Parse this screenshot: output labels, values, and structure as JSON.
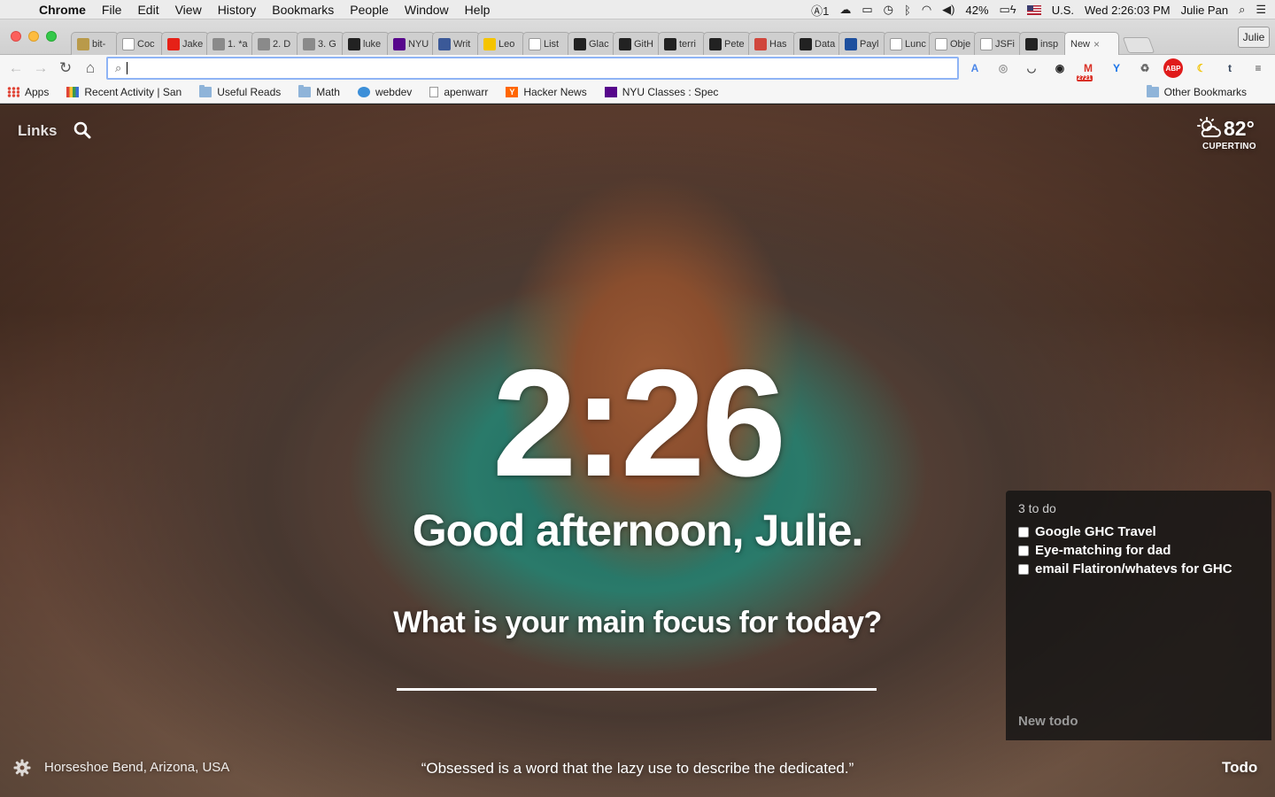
{
  "menubar": {
    "app_name": "Chrome",
    "items": [
      "File",
      "Edit",
      "View",
      "History",
      "Bookmarks",
      "People",
      "Window",
      "Help"
    ],
    "status": {
      "notifications_count": "1",
      "battery": "42%",
      "input_source": "U.S.",
      "datetime": "Wed 2:26:03 PM",
      "user": "Julie Pan"
    }
  },
  "tabs": [
    {
      "label": "bit-",
      "favicon_color": "#b99a4a",
      "icon": "page-icon"
    },
    {
      "label": "Coc",
      "favicon_color": "#ffffff",
      "icon": "page-icon"
    },
    {
      "label": "Jake",
      "favicon_color": "#e62117",
      "icon": "youtube-icon"
    },
    {
      "label": "1. *a",
      "favicon_color": "#8a8a8a",
      "icon": "doc-icon"
    },
    {
      "label": "2. D",
      "favicon_color": "#8a8a8a",
      "icon": "doc-icon"
    },
    {
      "label": "3. G",
      "favicon_color": "#8a8a8a",
      "icon": "doc-icon"
    },
    {
      "label": "luke",
      "favicon_color": "#222222",
      "icon": "github-icon"
    },
    {
      "label": "NYU",
      "favicon_color": "#57068c",
      "icon": "nyu-icon"
    },
    {
      "label": "Writ",
      "favicon_color": "#3b5998",
      "icon": "facebook-icon"
    },
    {
      "label": "Leo",
      "favicon_color": "#f5c400",
      "icon": "page-icon"
    },
    {
      "label": "List",
      "favicon_color": "#ffffff",
      "icon": "wikipedia-icon"
    },
    {
      "label": "Glac",
      "favicon_color": "#222222",
      "icon": "github-icon"
    },
    {
      "label": "GitH",
      "favicon_color": "#222222",
      "icon": "github-icon"
    },
    {
      "label": "terri",
      "favicon_color": "#222222",
      "icon": "github-icon"
    },
    {
      "label": "Pete",
      "favicon_color": "#222222",
      "icon": "wapo-icon"
    },
    {
      "label": "Has",
      "favicon_color": "#d0463c",
      "icon": "page-icon"
    },
    {
      "label": "Data",
      "favicon_color": "#222222",
      "icon": "github-icon"
    },
    {
      "label": "Payl",
      "favicon_color": "#1d4f9e",
      "icon": "paypal-icon"
    },
    {
      "label": "Lunc",
      "favicon_color": "#ffffff",
      "icon": "page-icon"
    },
    {
      "label": "Obje",
      "favicon_color": "#ffffff",
      "icon": "page-icon"
    },
    {
      "label": "JSFi",
      "favicon_color": "#ffffff",
      "icon": "page-icon"
    },
    {
      "label": "insp",
      "favicon_color": "#222222",
      "icon": "github-icon"
    },
    {
      "label": "New",
      "favicon_color": "#f6f6f6",
      "icon": "none",
      "active": true
    }
  ],
  "profile_button": "Julie",
  "omnibox": {
    "value": "",
    "placeholder": ""
  },
  "extensions": [
    {
      "name": "translate-icon",
      "glyph": "A",
      "color": "#4a86e8"
    },
    {
      "name": "ghostery-icon",
      "glyph": "◎",
      "color": "#999999"
    },
    {
      "name": "pocket-icon",
      "glyph": "◡",
      "color": "#444444"
    },
    {
      "name": "colorpicker-icon",
      "glyph": "◉",
      "color": "#222222"
    },
    {
      "name": "gmail-icon",
      "glyph": "M",
      "color": "#d93025",
      "badge": "2721"
    },
    {
      "name": "yelp-icon",
      "glyph": "Y",
      "color": "#1a73e8"
    },
    {
      "name": "recycle-icon",
      "glyph": "♻",
      "color": "#666666"
    },
    {
      "name": "adblock-icon",
      "glyph": "ABP",
      "color": "#e01b1b"
    },
    {
      "name": "moon-icon",
      "glyph": "☾",
      "color": "#f2c200"
    },
    {
      "name": "tumblr-icon",
      "glyph": "t",
      "color": "#36465d"
    },
    {
      "name": "menu-icon",
      "glyph": "≡",
      "color": "#444444"
    }
  ],
  "bookmarks": {
    "items": [
      {
        "label": "Apps",
        "icon": "apps-icon"
      },
      {
        "label": "Recent Activity | San",
        "icon": "stripe-icon"
      },
      {
        "label": "Useful Reads",
        "icon": "folder-icon"
      },
      {
        "label": "Math",
        "icon": "folder-icon"
      },
      {
        "label": "webdev",
        "icon": "webdev-icon"
      },
      {
        "label": "apenwarr",
        "icon": "page-icon"
      },
      {
        "label": "Hacker News",
        "icon": "ycombinator-icon"
      },
      {
        "label": "NYU Classes : Spec",
        "icon": "nyu-icon"
      }
    ],
    "other": "Other Bookmarks"
  },
  "momentum": {
    "links_label": "Links",
    "weather": {
      "temp": "82°",
      "location": "CUPERTINO"
    },
    "time": "2:26",
    "greeting": "Good afternoon, Julie.",
    "focus_question": "What is your main focus for today?",
    "focus_value": "",
    "todo": {
      "count_label": "3 to do",
      "items": [
        {
          "label": "Google GHC Travel",
          "done": false
        },
        {
          "label": "Eye-matching for dad",
          "done": false
        },
        {
          "label": "email Flatiron/whatevs for GHC",
          "done": false
        }
      ],
      "new_placeholder": "New todo"
    },
    "photo_location": "Horseshoe Bend, Arizona, USA",
    "quote": "“Obsessed is a word that the lazy use to describe the dedicated.”",
    "todo_toggle": "Todo"
  }
}
